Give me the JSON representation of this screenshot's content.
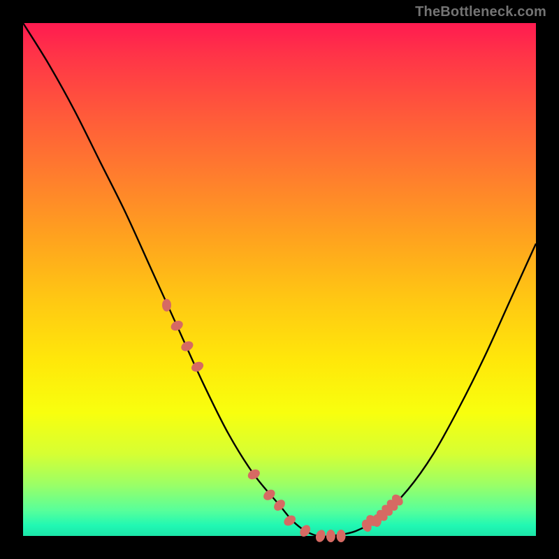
{
  "watermark": "TheBottleneck.com",
  "gradient_colors": {
    "top": "#ff1b50",
    "mid_upper": "#ff7e2d",
    "mid": "#ffe80a",
    "mid_lower": "#d6ff33",
    "bottom": "#1ce5a8"
  },
  "curve_color": "#000000",
  "marker_color": "#d66a63",
  "chart_data": {
    "type": "line",
    "title": "",
    "xlabel": "",
    "ylabel": "",
    "xlim": [
      0,
      100
    ],
    "ylim": [
      0,
      100
    ],
    "series": [
      {
        "name": "curve",
        "x": [
          0,
          5,
          10,
          15,
          20,
          25,
          30,
          35,
          40,
          45,
          50,
          52.5,
          55,
          57.5,
          60,
          65,
          70,
          75,
          80,
          85,
          90,
          95,
          100
        ],
        "y": [
          100,
          92,
          83,
          73,
          63,
          52,
          41,
          30,
          20,
          12,
          6,
          3,
          1,
          0,
          0,
          1,
          4,
          9,
          16,
          25,
          35,
          46,
          57
        ]
      }
    ],
    "markers": {
      "name": "highlight-points",
      "x": [
        28,
        30,
        32,
        34,
        45,
        48,
        50,
        52,
        55,
        58,
        60,
        62,
        67,
        68,
        69,
        70,
        71,
        72,
        73
      ],
      "y": [
        45,
        41,
        37,
        33,
        12,
        8,
        6,
        3,
        1,
        0,
        0,
        0,
        2,
        3,
        3,
        4,
        5,
        6,
        7
      ]
    }
  }
}
